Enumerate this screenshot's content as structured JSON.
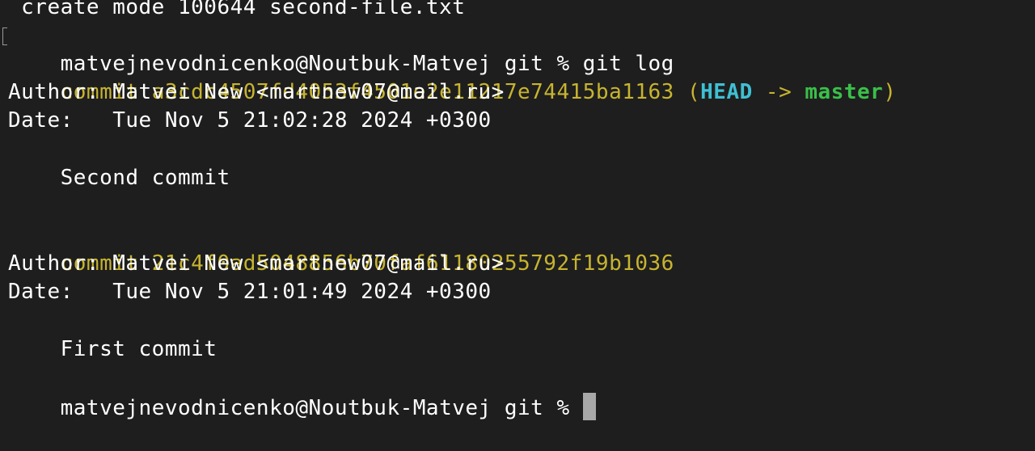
{
  "terminal": {
    "lines": {
      "create_mode": " create mode 100644 second-file.txt",
      "prompt1": "matvejnevodnicenko@Noutbuk-Matvej git % ",
      "command1": "git log",
      "commit1_keyword": "commit ",
      "commit1_hash": "a3cdc4507fd4053f4501e2e11217e74415ba1163",
      "commit1_ref_open": " (",
      "commit1_head": "HEAD",
      "commit1_arrow": " -> ",
      "commit1_branch": "master",
      "commit1_ref_close": ")",
      "commit1_author": "Author: Matvei New <martnew07@mail.ru>",
      "commit1_date": "Date:   Tue Nov 5 21:02:28 2024 +0300",
      "commit1_message": "    Second commit",
      "commit2_keyword": "commit ",
      "commit2_hash": "21c4f0ad5048856b70faf61180255792f19b1036",
      "commit2_author": "Author: Matvei New <martnew07@mail.ru>",
      "commit2_date": "Date:   Tue Nov 5 21:01:49 2024 +0300",
      "commit2_message": "    First commit",
      "prompt2": "matvejnevodnicenko@Noutbuk-Matvej git % "
    },
    "colors": {
      "background": "#1e1e1e",
      "text": "#ffffff",
      "commit": "#c7b42f",
      "head": "#3fbfd3",
      "branch": "#3ac049",
      "cursor": "#a8a8a8"
    }
  }
}
